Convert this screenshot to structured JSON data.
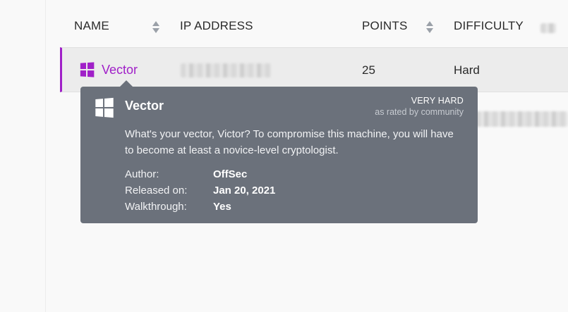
{
  "table": {
    "headers": {
      "name": "NAME",
      "ip_address": "IP ADDRESS",
      "points": "POINTS",
      "difficulty": "DIFFICULTY"
    },
    "row": {
      "name": "Vector",
      "points": "25",
      "difficulty": "Hard",
      "os_icon": "windows-icon",
      "accent_color": "#a020c8"
    }
  },
  "tooltip": {
    "title": "Vector",
    "rating": "VERY HARD",
    "rating_source": "as rated by community",
    "description": "What's your vector, Victor? To compromise this machine, you will have to become at least a novice-level cryptologist.",
    "meta": [
      {
        "label": "Author:",
        "value": "OffSec"
      },
      {
        "label": "Released on:",
        "value": "Jan 20, 2021"
      },
      {
        "label": "Walkthrough:",
        "value": "Yes"
      }
    ],
    "background_color": "#6b717b"
  }
}
